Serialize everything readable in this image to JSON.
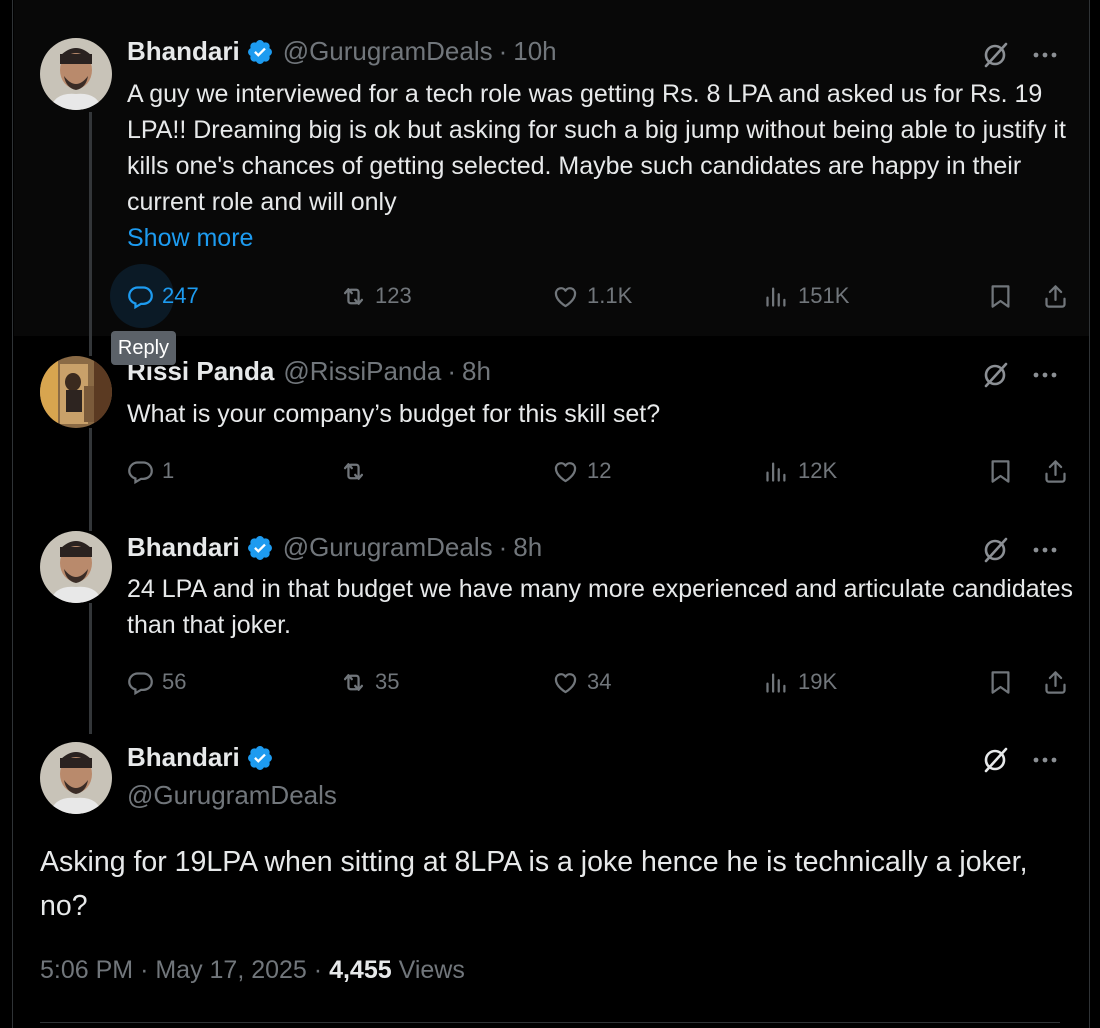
{
  "tweets": [
    {
      "name": "Bhandari",
      "handle": "@GurugramDeals",
      "time": "10h",
      "text": "A guy we interviewed for a tech role was getting Rs. 8 LPA and asked us for Rs. 19 LPA!! Dreaming big is ok but asking for such a big jump without being able to justify it kills one's chances of getting selected. Maybe such candidates are happy in their current role and will only",
      "show_more": "Show more",
      "replies": "247",
      "reposts": "123",
      "likes": "1.1K",
      "views": "151K"
    },
    {
      "name": "Rissi Panda",
      "handle": "@RissiPanda",
      "time": "8h",
      "text": "What is your company’s budget for this skill set?",
      "replies": "1",
      "reposts": "",
      "likes": "12",
      "views": "12K"
    },
    {
      "name": "Bhandari",
      "handle": "@GurugramDeals",
      "time": "8h",
      "text": "24 LPA and in that budget we have many more experienced and articulate candidates than that joker.",
      "replies": "56",
      "reposts": "35",
      "likes": "34",
      "views": "19K"
    }
  ],
  "main_tweet": {
    "name": "Bhandari",
    "handle": "@GurugramDeals",
    "text": "Asking for 19LPA when sitting at 8LPA is a joke hence he is technically a joker, no?",
    "time": "5:06 PM",
    "date": "May 17, 2025",
    "views_count": "4,455",
    "views_label": "Views"
  },
  "tooltip": "Reply",
  "separator": "·",
  "colors": {
    "background": "#000000",
    "text": "#e7e9ea",
    "muted": "#71767b",
    "accent": "#1d9bf0"
  },
  "icons": [
    "verified-badge-icon",
    "grok-icon",
    "more-icon",
    "reply-icon",
    "repost-icon",
    "like-icon",
    "views-icon",
    "bookmark-icon",
    "share-icon"
  ]
}
